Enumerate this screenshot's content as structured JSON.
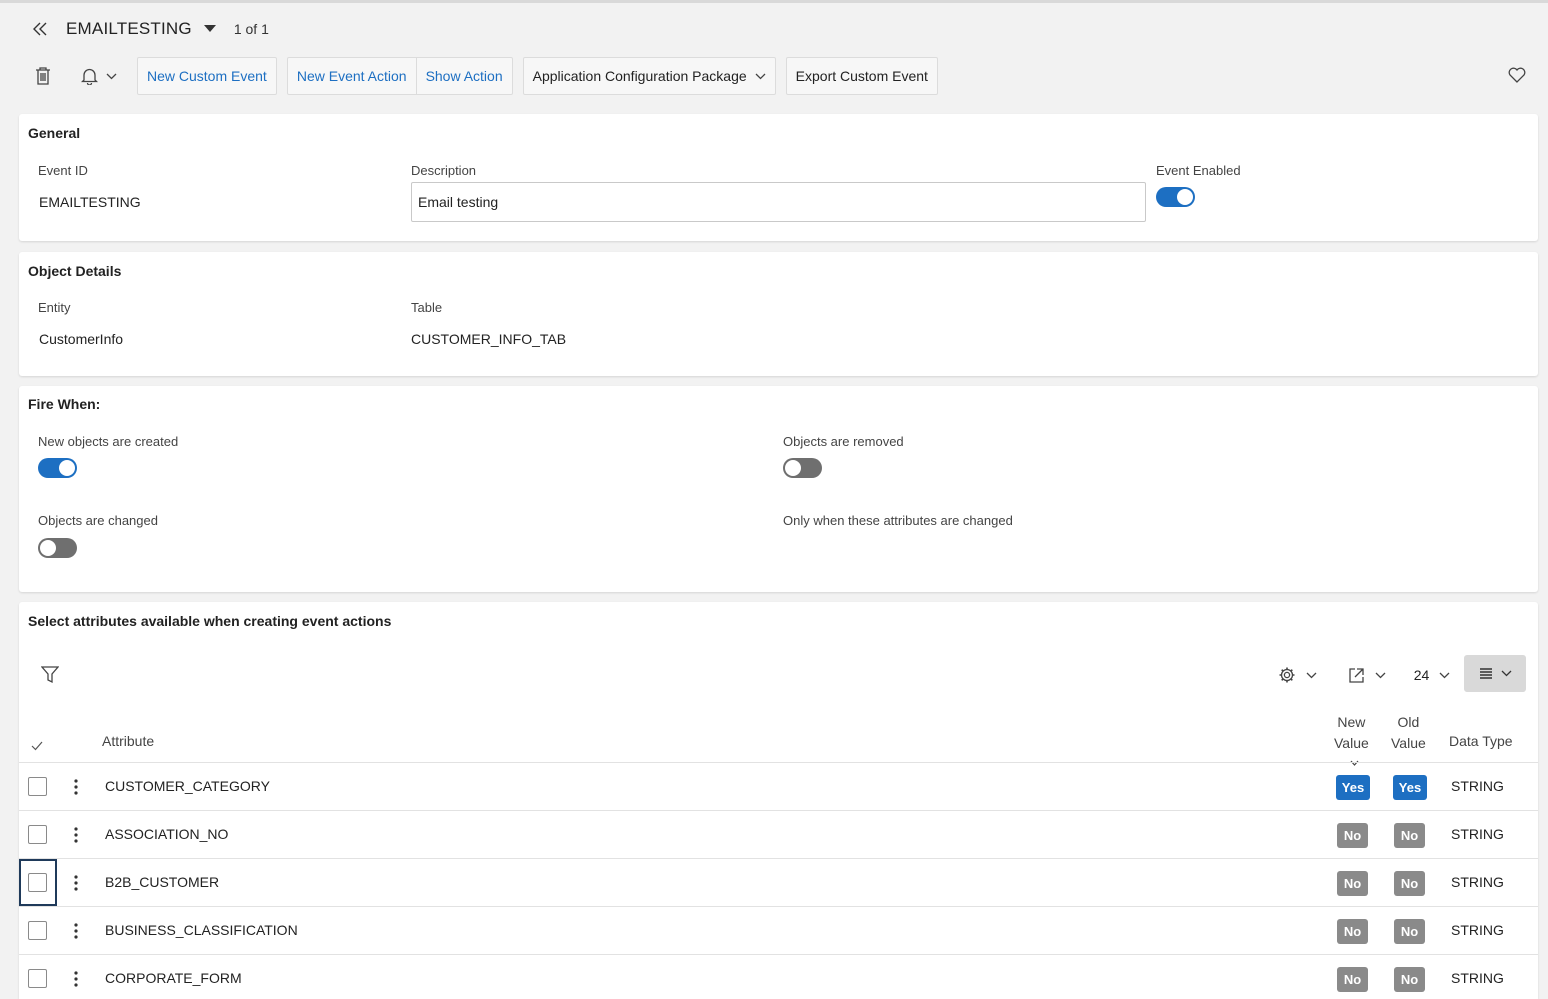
{
  "header": {
    "title": "EMAILTESTING",
    "record_count": "1 of 1"
  },
  "toolbar": {
    "new_custom_event": "New Custom Event",
    "new_event_action": "New Event Action",
    "show_action": "Show Action",
    "app_config_package": "Application Configuration Package",
    "export_custom_event": "Export Custom Event"
  },
  "general": {
    "title": "General",
    "event_id_label": "Event ID",
    "event_id_value": "EMAILTESTING",
    "description_label": "Description",
    "description_value": "Email testing",
    "event_enabled_label": "Event Enabled",
    "event_enabled": true
  },
  "object_details": {
    "title": "Object Details",
    "entity_label": "Entity",
    "entity_value": "CustomerInfo",
    "table_label": "Table",
    "table_value": "CUSTOMER_INFO_TAB"
  },
  "fire_when": {
    "title": "Fire When:",
    "created_label": "New objects are created",
    "created": true,
    "removed_label": "Objects are removed",
    "removed": false,
    "changed_label": "Objects are changed",
    "changed": false,
    "only_when_label": "Only when these attributes are changed"
  },
  "attributes": {
    "title": "Select attributes available when creating event actions",
    "page_size": "24",
    "columns": {
      "attribute": "Attribute",
      "new_value_1": "New",
      "new_value_2": "Value",
      "old_value_1": "Old",
      "old_value_2": "Value",
      "data_type": "Data Type"
    },
    "rows": [
      {
        "attribute": "CUSTOMER_CATEGORY",
        "new_value": "Yes",
        "old_value": "Yes",
        "data_type": "STRING"
      },
      {
        "attribute": "ASSOCIATION_NO",
        "new_value": "No",
        "old_value": "No",
        "data_type": "STRING"
      },
      {
        "attribute": "B2B_CUSTOMER",
        "new_value": "No",
        "old_value": "No",
        "data_type": "STRING"
      },
      {
        "attribute": "BUSINESS_CLASSIFICATION",
        "new_value": "No",
        "old_value": "No",
        "data_type": "STRING"
      },
      {
        "attribute": "CORPORATE_FORM",
        "new_value": "No",
        "old_value": "No",
        "data_type": "STRING"
      }
    ]
  },
  "colors": {
    "accent": "#1d6fc2",
    "badge_no": "#8a8a8a",
    "toggle_off": "#6f6f6f",
    "background": "#f2f2f2"
  }
}
